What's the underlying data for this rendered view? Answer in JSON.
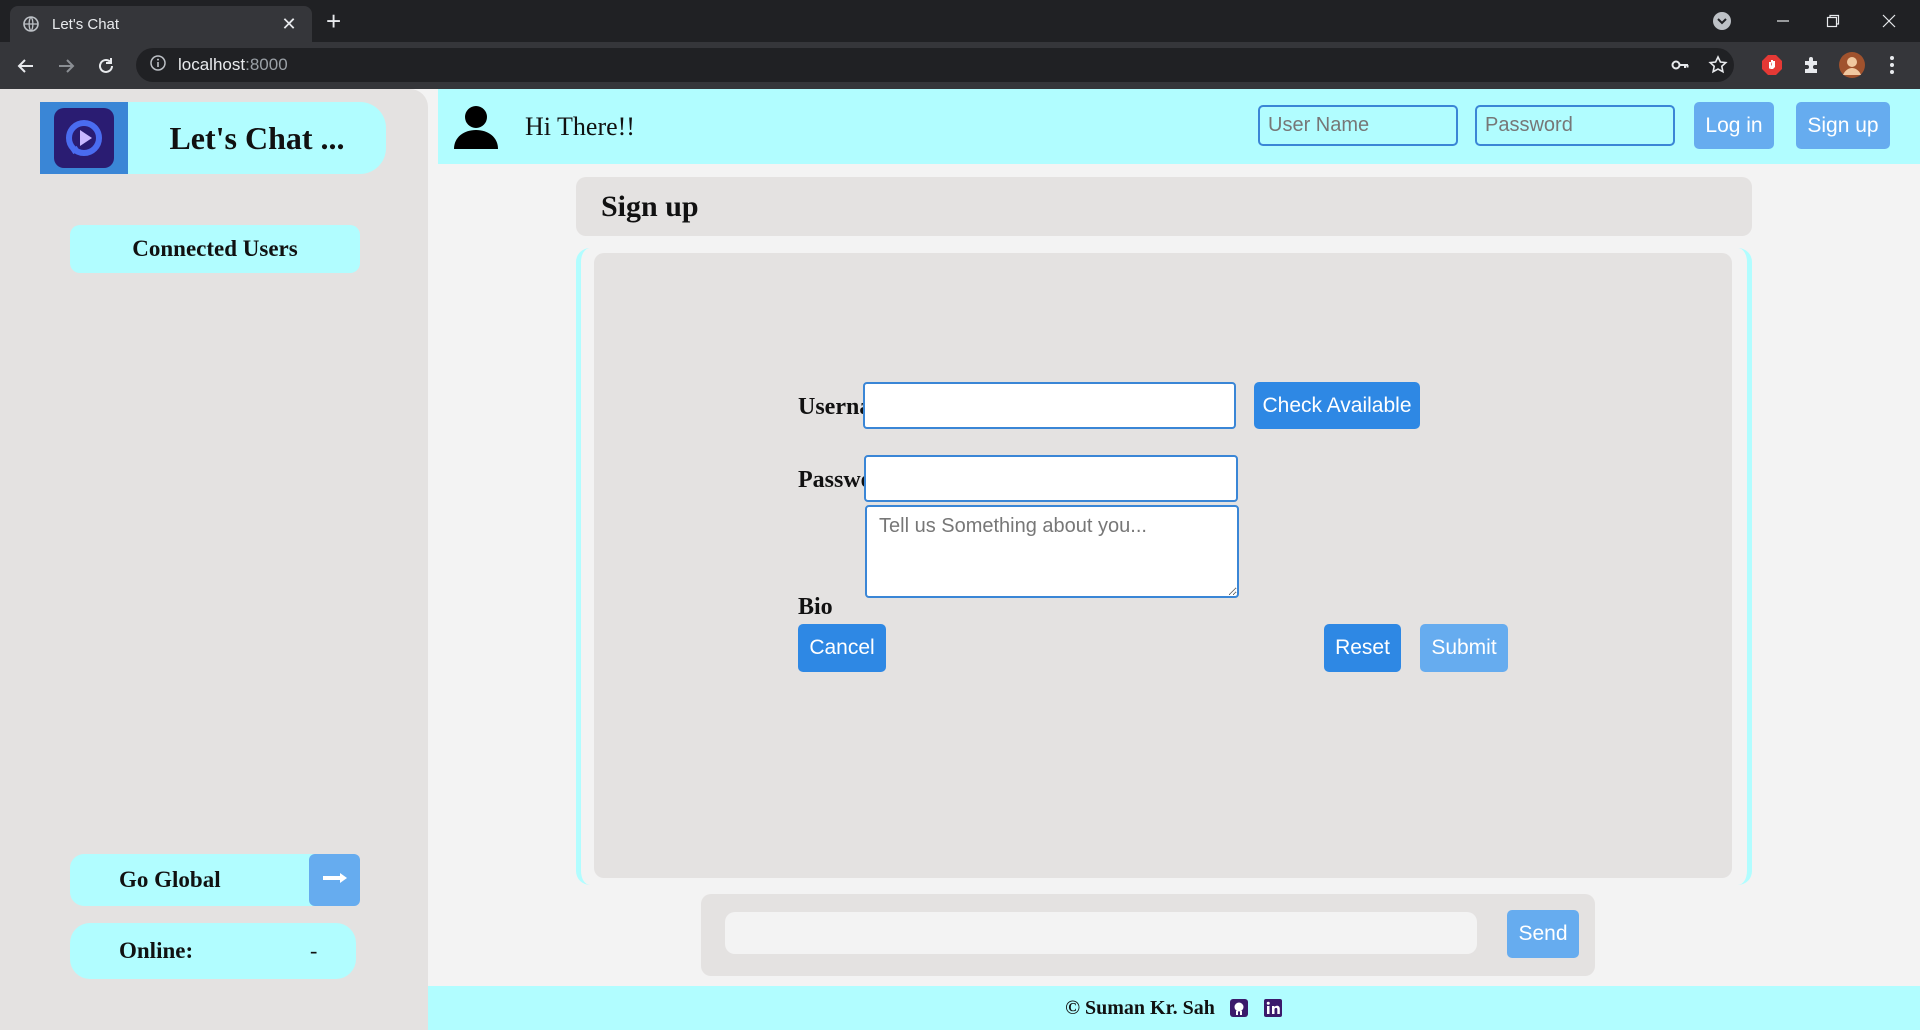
{
  "browser": {
    "tab_title": "Let's Chat",
    "address_host": "localhost",
    "address_port": ":8000"
  },
  "sidebar": {
    "brand_title": "Let's Chat ...",
    "connected_users_label": "Connected Users",
    "go_global_label": "Go Global",
    "online_label": "Online:",
    "online_value": "-"
  },
  "topbar": {
    "greeting": "Hi There!!",
    "username_placeholder": "User Name",
    "password_placeholder": "Password",
    "login_label": "Log in",
    "signup_label": "Sign up"
  },
  "signup": {
    "title": "Sign up",
    "username_label": "Username",
    "password_label": "Password",
    "bio_label": "Bio",
    "bio_placeholder": "Tell us Something about you...",
    "check_available_label": "Check Available",
    "cancel_label": "Cancel",
    "reset_label": "Reset",
    "submit_label": "Submit"
  },
  "composer": {
    "send_label": "Send"
  },
  "footer": {
    "credit": "© Suman Kr. Sah"
  },
  "colors": {
    "accent_cyan": "#b1fdff",
    "button_blue": "#2e88e4",
    "button_blue_light": "#66acef",
    "panel_gray": "#e4e2e1"
  },
  "icons": [
    "globe-icon",
    "close-icon",
    "plus-icon",
    "chevron-down-icon",
    "minimize-icon",
    "restore-icon",
    "back-arrow-icon",
    "forward-arrow-icon",
    "reload-icon",
    "info-icon",
    "key-icon",
    "star-icon",
    "adblock-icon",
    "puzzle-icon",
    "profile-avatar-icon",
    "more-icon",
    "play-logo-icon",
    "user-silhouette-icon",
    "arrow-right-icon",
    "github-icon",
    "linkedin-icon"
  ]
}
